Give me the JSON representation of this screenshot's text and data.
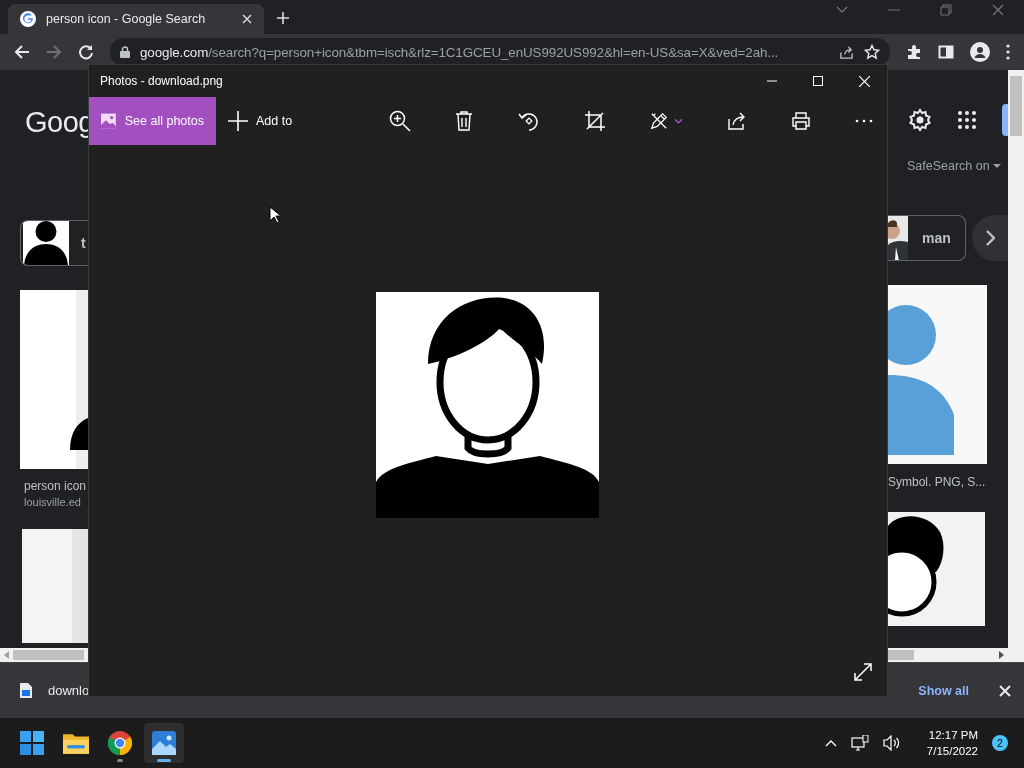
{
  "browser": {
    "tab": {
      "title": "person icon - Google Search",
      "selected": true
    },
    "address_host": "google.com",
    "address_path": "/search?q=person+icon&tbm=isch&rlz=1C1GCEU_enUS992US992&hl=en-US&sa=X&ved=2ah...",
    "forward_disabled": true
  },
  "page": {
    "logo": "Goog",
    "safesearch": "SafeSearch on",
    "chips": [
      {
        "label": "t"
      },
      {
        "label": "man"
      }
    ],
    "results": [
      {
        "title": "person icon",
        "source": "louisville.ed"
      },
      {
        "title": "Symbol. PNG, S..."
      }
    ]
  },
  "downloads": {
    "file": "downlo",
    "show_all": "Show all"
  },
  "photos": {
    "title": "Photos - download.png",
    "toolbar": [
      {
        "kind": "primary",
        "label": "See all photos"
      },
      {
        "kind": "text",
        "label": "Add to"
      }
    ]
  },
  "taskbar": {
    "apps": [
      {
        "kind": "start",
        "selected": false,
        "running": false
      },
      {
        "kind": "files",
        "selected": false,
        "running": false
      },
      {
        "kind": "browser",
        "selected": false,
        "running": true
      },
      {
        "kind": "photos",
        "selected": true,
        "running": true
      }
    ],
    "time": "12:17 PM",
    "date": "7/15/2022",
    "notifications": "2"
  }
}
